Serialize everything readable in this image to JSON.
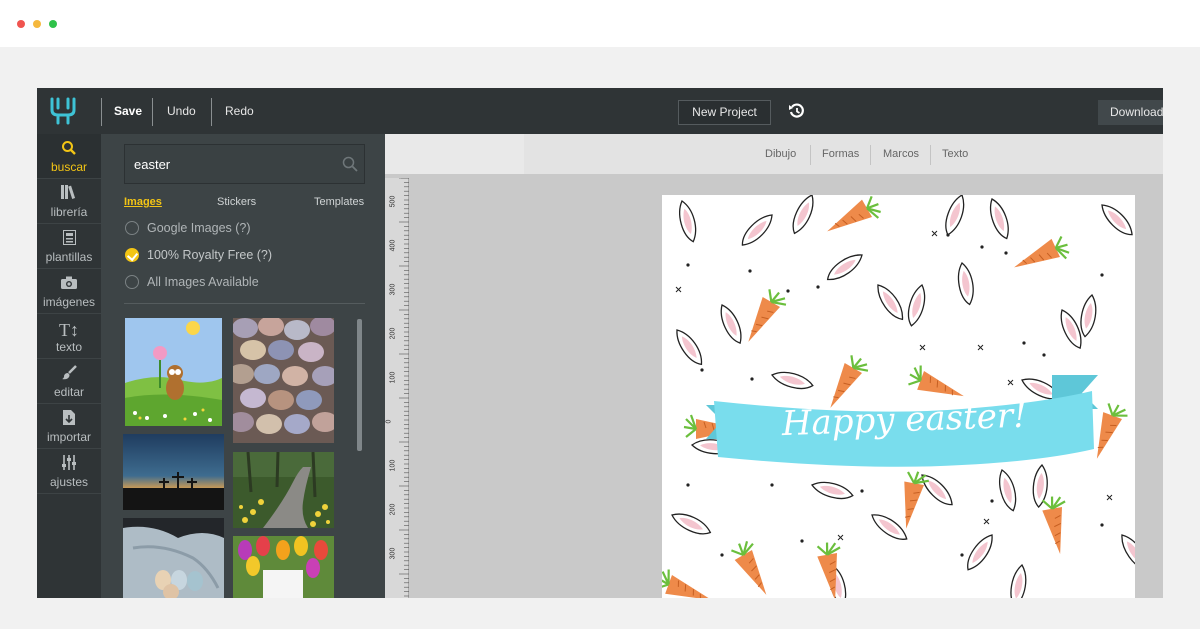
{
  "toolbar": {
    "save_label": "Save",
    "undo_label": "Undo",
    "redo_label": "Redo",
    "new_project_label": "New Project",
    "download_label": "Download"
  },
  "sidebar": {
    "items": [
      {
        "label": "buscar",
        "icon": "search-icon"
      },
      {
        "label": "librería",
        "icon": "library-icon"
      },
      {
        "label": "plantillas",
        "icon": "template-icon"
      },
      {
        "label": "imágenes",
        "icon": "camera-icon"
      },
      {
        "label": "texto",
        "icon": "text-icon"
      },
      {
        "label": "editar",
        "icon": "brush-icon"
      },
      {
        "label": "importar",
        "icon": "import-icon"
      },
      {
        "label": "ajustes",
        "icon": "sliders-icon"
      }
    ]
  },
  "search": {
    "value": "easter",
    "tabs": [
      "Images",
      "Stickers",
      "Templates"
    ],
    "options": [
      {
        "label": "Google Images (?)",
        "checked": false
      },
      {
        "label": "100% Royalty Free (?)",
        "checked": true
      },
      {
        "label": "All Images Available",
        "checked": false
      }
    ]
  },
  "tool_tabs": [
    "Dibujo",
    "Formas",
    "Marcos",
    "Texto"
  ],
  "ruler": [
    "500",
    "400",
    "300",
    "200",
    "100",
    "0",
    "100",
    "200",
    "300"
  ],
  "canvas": {
    "banner_text": "Happy easter!"
  },
  "colors": {
    "accent": "#f3c515",
    "topbar": "#2f3436",
    "banner": "#79dded",
    "carrot": "#ee8a4a"
  }
}
